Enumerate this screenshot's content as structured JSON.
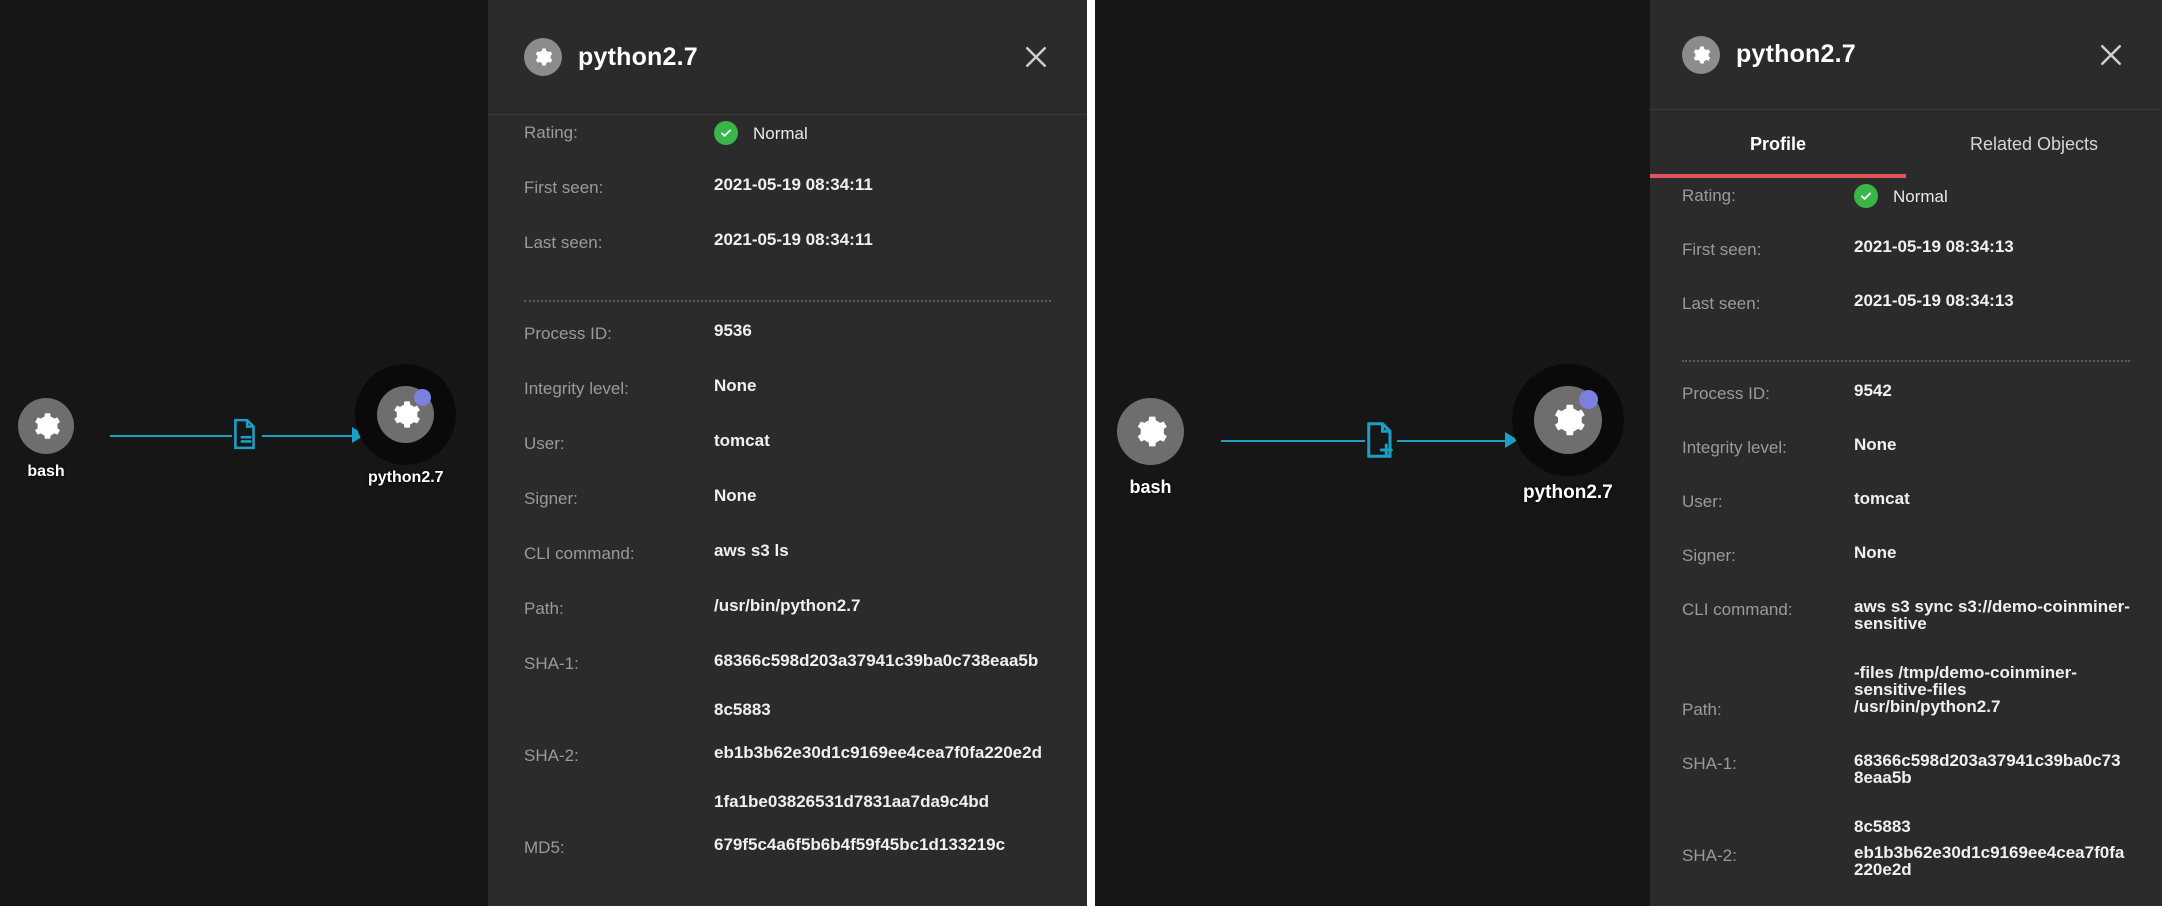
{
  "screenshots": [
    {
      "id": "left",
      "graph": {
        "source_node": {
          "label": "bash",
          "icon": "gear-icon"
        },
        "target_node": {
          "label": "python2.7",
          "icon": "gear-icon",
          "badge": "violet-dot",
          "selected": true
        },
        "edge_icon": "file-icon",
        "edge_color": "#1b9fc4"
      },
      "panel": {
        "title": "python2.7",
        "title_icon": "gear-icon",
        "close_icon": "close-icon",
        "has_tabs": false,
        "rows": [
          {
            "label": "Rating:",
            "value": "Normal",
            "type": "status",
            "status_icon": "check-circle-icon",
            "status_color": "#3ab549"
          },
          {
            "label": "First seen:",
            "value": "2021-05-19 08:34:11",
            "type": "text"
          },
          {
            "label": "Last seen:",
            "value": "2021-05-19 08:34:11",
            "type": "text"
          },
          {
            "type": "separator"
          },
          {
            "label": "Process ID:",
            "value": "9536",
            "type": "text"
          },
          {
            "label": "Integrity level:",
            "value": "None",
            "type": "text"
          },
          {
            "label": "User:",
            "value": "tomcat",
            "type": "text"
          },
          {
            "label": "Signer:",
            "value": "None",
            "type": "text"
          },
          {
            "label": "CLI command:",
            "value": "aws s3 ls",
            "type": "text"
          },
          {
            "label": "Path:",
            "value": "/usr/bin/python2.7",
            "type": "text"
          },
          {
            "label": "SHA-1:",
            "type": "multiline",
            "lines": [
              "68366c598d203a37941c39ba0c738eaa5b",
              "8c5883"
            ]
          },
          {
            "label": "SHA-2:",
            "type": "multiline",
            "lines": [
              "eb1b3b62e30d1c9169ee4cea7f0fa220e2d",
              "1fa1be03826531d7831aa7da9c4bd"
            ]
          },
          {
            "label": "MD5:",
            "value": "679f5c4a6f5b6b4f59f45bc1d133219c",
            "type": "text"
          }
        ]
      }
    },
    {
      "id": "right",
      "graph": {
        "source_node": {
          "label": "bash",
          "icon": "gear-icon"
        },
        "target_node": {
          "label": "python2.7",
          "icon": "gear-icon",
          "badge": "violet-dot",
          "selected": true
        },
        "edge_icon": "file-add-icon",
        "edge_color": "#1b9fc4"
      },
      "panel": {
        "title": "python2.7",
        "title_icon": "gear-icon",
        "close_icon": "close-icon",
        "has_tabs": true,
        "tabs": [
          {
            "label": "Profile",
            "active": true
          },
          {
            "label": "Related Objects",
            "active": false
          }
        ],
        "active_tab_color": "#e0575b",
        "rows": [
          {
            "label": "Rating:",
            "value": "Normal",
            "type": "status",
            "status_icon": "check-circle-icon",
            "status_color": "#3ab549"
          },
          {
            "label": "First seen:",
            "value": "2021-05-19 08:34:13",
            "type": "text"
          },
          {
            "label": "Last seen:",
            "value": "2021-05-19 08:34:13",
            "type": "text"
          },
          {
            "type": "separator"
          },
          {
            "label": "Process ID:",
            "value": "9542",
            "type": "text"
          },
          {
            "label": "Integrity level:",
            "value": "None",
            "type": "text"
          },
          {
            "label": "User:",
            "value": "tomcat",
            "type": "text"
          },
          {
            "label": "Signer:",
            "value": "None",
            "type": "text"
          },
          {
            "label": "CLI command:",
            "type": "multiline",
            "lines": [
              "aws s3 sync s3://demo-coinminer-sensitive",
              "-files /tmp/demo-coinminer-sensitive-files"
            ]
          },
          {
            "label": "Path:",
            "value": "/usr/bin/python2.7",
            "type": "text"
          },
          {
            "label": "SHA-1:",
            "type": "multiline",
            "lines": [
              "68366c598d203a37941c39ba0c738eaa5b",
              "8c5883"
            ]
          },
          {
            "label": "SHA-2:",
            "type": "multiline",
            "lines": [
              "eb1b3b62e30d1c9169ee4cea7f0fa220e2d"
            ]
          }
        ]
      }
    }
  ],
  "colors": {
    "panel_bg": "#2b2b2b",
    "canvas_bg": "#161616",
    "accent_edge": "#1b9fc4",
    "status_green": "#3ab549",
    "tab_underline": "#e0575b",
    "badge_violet": "#7b7fe0",
    "node_gray": "#6e6e6e"
  }
}
